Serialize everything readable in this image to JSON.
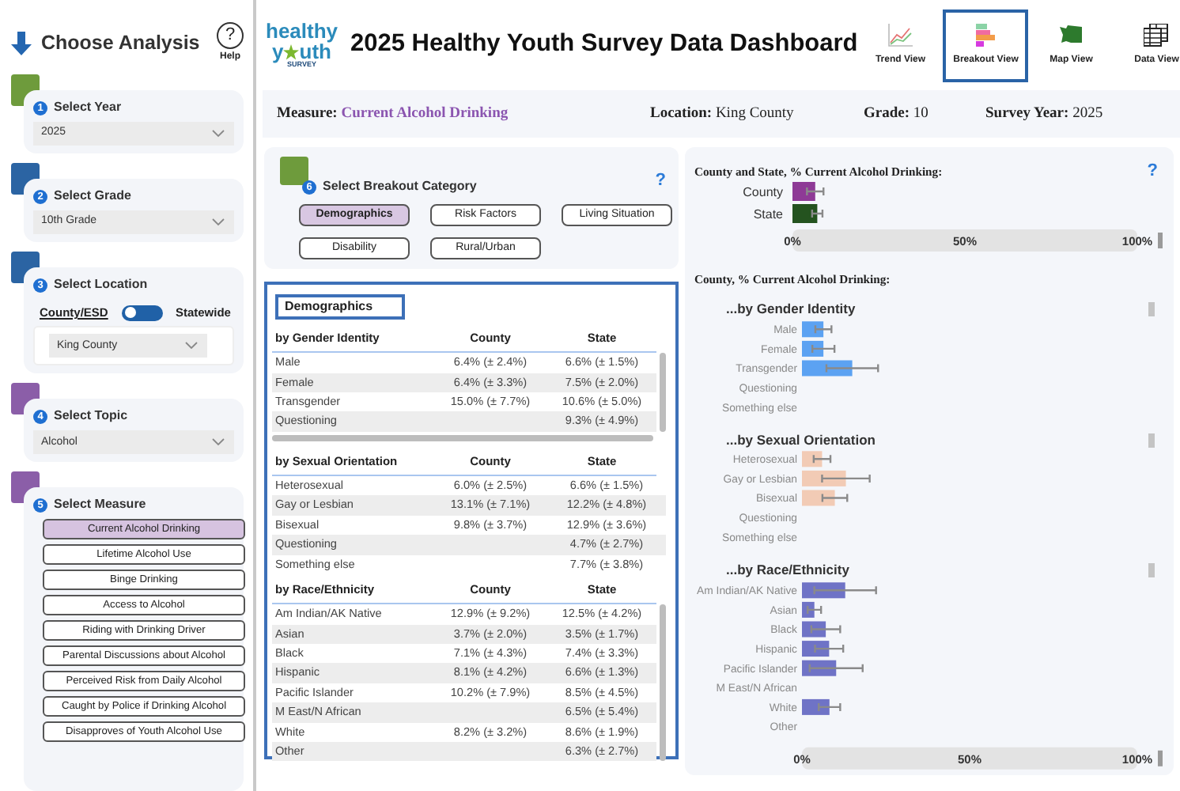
{
  "sidebar": {
    "title": "Choose Analysis",
    "help": {
      "icon": "?",
      "label": "Help"
    },
    "steps": [
      {
        "kind": "dropdown",
        "number": "1",
        "label": "Select Year",
        "color": "#6e9b3c",
        "value": "2025"
      },
      {
        "kind": "dropdown",
        "number": "2",
        "label": "Select Grade",
        "color": "#2b64a3",
        "value": "10th Grade"
      },
      {
        "kind": "location",
        "number": "3",
        "label": "Select Location",
        "color": "#2b64a3",
        "options": [
          {
            "label": "County/ESD",
            "selected": true
          },
          {
            "label": "Statewide",
            "selected": false
          }
        ],
        "value": "King County"
      },
      {
        "kind": "dropdown",
        "number": "4",
        "label": "Select Topic",
        "color": "#8b5ea8",
        "value": "Alcohol"
      },
      {
        "kind": "buttons",
        "number": "5",
        "label": "Select Measure",
        "color": "#8b5ea8",
        "buttons": [
          {
            "label": "Current Alcohol Drinking",
            "selected": true
          },
          {
            "label": "Lifetime Alcohol Use",
            "selected": false
          },
          {
            "label": "Binge Drinking",
            "selected": false
          },
          {
            "label": "Access to Alcohol",
            "selected": false
          },
          {
            "label": "Riding with Drinking Driver",
            "selected": false
          },
          {
            "label": "Parental Discussions about Alcohol",
            "selected": false
          },
          {
            "label": "Perceived Risk from Daily Alcohol",
            "selected": false
          },
          {
            "label": "Caught by Police if Drinking Alcohol",
            "selected": false
          },
          {
            "label": "Disapproves of Youth Alcohol Use",
            "selected": false
          }
        ]
      }
    ]
  },
  "header": {
    "logo": {
      "word1": "healthy",
      "word2_start": "y",
      "word2_end": "uth",
      "word3": "SURVEY"
    },
    "title": "2025 Healthy Youth Survey Data Dashboard",
    "views": [
      {
        "kind": "trend",
        "label": "Trend View",
        "selected": false
      },
      {
        "kind": "breakout",
        "label": "Breakout View",
        "selected": true
      },
      {
        "kind": "map",
        "label": "Map View",
        "selected": false
      },
      {
        "kind": "data",
        "label": "Data View",
        "selected": false
      }
    ]
  },
  "summary": [
    {
      "label": "Measure:",
      "value": "Current Alcohol Drinking",
      "highlight": true
    },
    {
      "label": "Location:",
      "value": "King County",
      "highlight": false
    },
    {
      "label": "Grade:",
      "value": "10",
      "highlight": false
    },
    {
      "label": "Survey Year:",
      "value": "2025",
      "highlight": false
    }
  ],
  "breakout": {
    "number": "6",
    "label": "Select Breakout Category",
    "color": "#6e9b3c",
    "help": "?",
    "categories": [
      {
        "label": "Demographics",
        "selected": true
      },
      {
        "label": "Risk Factors",
        "selected": false
      },
      {
        "label": "Living Situation",
        "selected": false
      },
      {
        "label": "Disability",
        "selected": false
      },
      {
        "label": "Rural/Urban",
        "selected": false
      }
    ]
  },
  "table": {
    "title": "Demographics",
    "sections": [
      {
        "heading": "by Gender Identity",
        "columns": [
          "County",
          "State"
        ],
        "vscroll": true,
        "hscroll": true,
        "rows": [
          {
            "label": "Male",
            "county": "6.4% (± 2.4%)",
            "state": "6.6% (± 1.5%)"
          },
          {
            "label": "Female",
            "county": "6.4% (± 3.3%)",
            "state": "7.5% (± 2.0%)"
          },
          {
            "label": "Transgender",
            "county": "15.0% (± 7.7%)",
            "state": "10.6% (± 5.0%)"
          },
          {
            "label": "Questioning",
            "state": "9.3% (± 4.9%)"
          }
        ]
      },
      {
        "heading": "by Sexual Orientation",
        "columns": [
          "County",
          "State"
        ],
        "vscroll": false,
        "hscroll": false,
        "rows": [
          {
            "label": "Heterosexual",
            "county": "6.0% (± 2.5%)",
            "state": "6.6% (± 1.5%)"
          },
          {
            "label": "Gay or Lesbian",
            "county": "13.1% (± 7.1%)",
            "state": "12.2% (± 4.8%)"
          },
          {
            "label": "Bisexual",
            "county": "9.8% (± 3.7%)",
            "state": "12.9% (± 3.6%)"
          },
          {
            "label": "Questioning",
            "state": "4.7% (± 2.7%)"
          },
          {
            "label": "Something else",
            "state": "7.7% (± 3.8%)"
          }
        ]
      },
      {
        "heading": "by Race/Ethnicity",
        "columns": [
          "County",
          "State"
        ],
        "vscroll": true,
        "hscroll": false,
        "rows": [
          {
            "label": "Am Indian/AK Native",
            "county": "12.9% (± 9.2%)",
            "state": "12.5% (± 4.2%)"
          },
          {
            "label": "Asian",
            "county": "3.7% (± 2.0%)",
            "state": "3.5% (± 1.7%)"
          },
          {
            "label": "Black",
            "county": "7.1% (± 4.3%)",
            "state": "7.4% (± 3.3%)"
          },
          {
            "label": "Hispanic",
            "county": "8.1% (± 4.2%)",
            "state": "6.6% (± 1.3%)"
          },
          {
            "label": "Pacific Islander",
            "county": "10.2% (± 7.9%)",
            "state": "8.5% (± 4.5%)"
          },
          {
            "label": "M East/N African",
            "state": "6.5% (± 5.4%)"
          },
          {
            "label": "White",
            "county": "8.2% (± 3.2%)",
            "state": "8.6% (± 1.9%)"
          },
          {
            "label": "Other",
            "state": "6.3% (± 2.7%)"
          }
        ]
      }
    ]
  },
  "charts": {
    "help": "?",
    "overall": {
      "chart_data": {
        "type": "bar",
        "orientation": "horizontal",
        "stacked": true,
        "title": "County and State, % Current Alcohol Drinking:",
        "categories": [
          "County",
          "State"
        ],
        "xlim": [
          0,
          100
        ],
        "series": [
          {
            "color": "#8e3a96",
            "values": [
              6.6,
              null
            ],
            "errors": [
              2.4,
              null
            ]
          },
          {
            "color": "#24531f",
            "values": [
              null,
              7.2
            ],
            "errors": [
              null,
              1.5
            ]
          }
        ],
        "xticks": [
          {
            "value": 0,
            "label": "0%"
          },
          {
            "value": 50,
            "label": "50%"
          },
          {
            "value": 100,
            "label": "100%"
          }
        ]
      }
    },
    "county_title": "County, % Current Alcohol Drinking:",
    "groups": [
      {
        "chart_data": {
          "type": "bar",
          "orientation": "horizontal",
          "title": "...by Gender Identity",
          "categories": [
            "Male",
            "Female",
            "Transgender",
            "Questioning",
            "Something else"
          ],
          "xlim": [
            0,
            100
          ],
          "series": [
            {
              "color": "#5ca2f2",
              "values": [
                6.4,
                6.4,
                15.0,
                null,
                null
              ],
              "errors": [
                2.4,
                3.3,
                7.7,
                null,
                null
              ]
            }
          ]
        }
      },
      {
        "chart_data": {
          "type": "bar",
          "orientation": "horizontal",
          "title": "...by Sexual Orientation",
          "categories": [
            "Heterosexual",
            "Gay or Lesbian",
            "Bisexual",
            "Questioning",
            "Something else"
          ],
          "xlim": [
            0,
            100
          ],
          "series": [
            {
              "color": "#f2cbb5",
              "values": [
                6.0,
                13.1,
                9.8,
                null,
                null
              ],
              "errors": [
                2.5,
                7.1,
                3.7,
                null,
                null
              ]
            }
          ]
        }
      },
      {
        "chart_data": {
          "type": "bar",
          "orientation": "horizontal",
          "title": "...by Race/Ethnicity",
          "categories": [
            "Am Indian/AK Native",
            "Asian",
            "Black",
            "Hispanic",
            "Pacific Islander",
            "M East/N African",
            "White",
            "Other"
          ],
          "xlim": [
            0,
            100
          ],
          "series": [
            {
              "color": "#6f73c6",
              "values": [
                12.9,
                3.7,
                7.1,
                8.1,
                10.2,
                null,
                8.2,
                null
              ],
              "errors": [
                9.2,
                2.0,
                4.3,
                4.2,
                7.9,
                null,
                3.2,
                null
              ]
            }
          ],
          "xticks": [
            {
              "value": 0,
              "label": "0%"
            },
            {
              "value": 50,
              "label": "50%"
            },
            {
              "value": 100,
              "label": "100%"
            }
          ]
        }
      }
    ]
  }
}
